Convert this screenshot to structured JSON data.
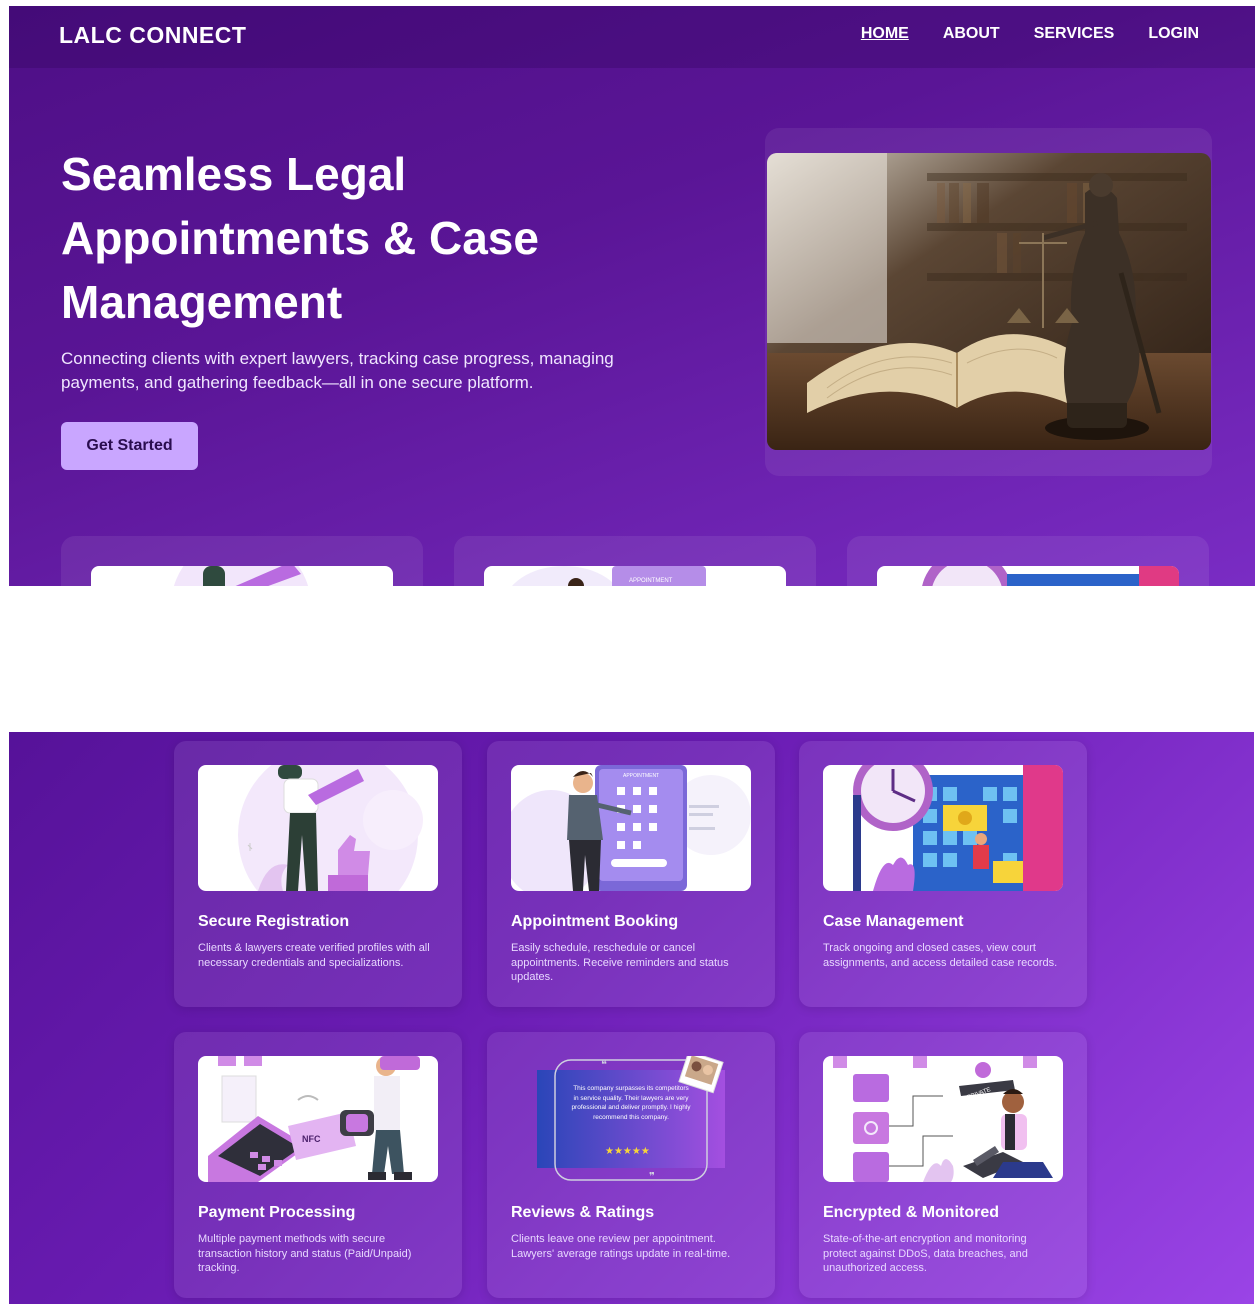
{
  "nav": {
    "logo": "LALC CONNECT",
    "links": [
      "HOME",
      "ABOUT",
      "SERVICES",
      "LOGIN"
    ]
  },
  "hero": {
    "title": "Seamless Legal Appointments & Case Management",
    "subtitle": "Connecting clients with expert lawyers, tracking case progress, managing payments, and gathering feedback—all in one secure platform.",
    "cta_label": "Get Started"
  },
  "illustration_text": {
    "appointment": "APPOINTMENT",
    "nfc": "NFC",
    "private": "PRIVATE",
    "review_quote": "This company surpasses its competitors in service quality. Their lawyers are very professional and deliver promptly. I highly recommend this company.",
    "stars": "★★★★★"
  },
  "features": [
    {
      "title": "Secure Registration",
      "desc": "Clients & lawyers create verified profiles with all necessary credentials and specializations."
    },
    {
      "title": "Appointment Booking",
      "desc": "Easily schedule, reschedule or cancel appointments. Receive reminders and status updates."
    },
    {
      "title": "Case Management",
      "desc": "Track ongoing and closed cases, view court assignments, and access detailed case records."
    },
    {
      "title": "Payment Processing",
      "desc": "Multiple payment methods with secure transaction history and status (Paid/Unpaid) tracking."
    },
    {
      "title": "Reviews & Ratings",
      "desc": "Clients leave one review per appointment. Lawyers' average ratings update in real-time."
    },
    {
      "title": "Encrypted & Monitored",
      "desc": "State-of-the-art encryption and monitoring protect against DDoS, data breaches, and unauthorized access."
    }
  ],
  "colors": {
    "accent": "#c9a6ff",
    "brand": "#5a1596",
    "illustration": "#b96be0"
  }
}
